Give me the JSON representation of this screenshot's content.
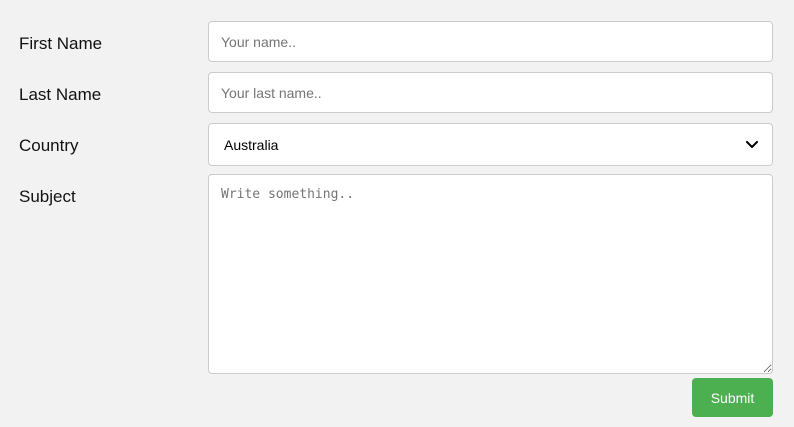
{
  "form": {
    "first_name": {
      "label": "First Name",
      "placeholder": "Your name..",
      "value": ""
    },
    "last_name": {
      "label": "Last Name",
      "placeholder": "Your last name..",
      "value": ""
    },
    "country": {
      "label": "Country",
      "selected": "Australia"
    },
    "subject": {
      "label": "Subject",
      "placeholder": "Write something..",
      "value": ""
    },
    "submit_label": "Submit"
  },
  "icons": {
    "dropdown": "chevron-down-icon"
  },
  "colors": {
    "background": "#f2f2f2",
    "submit": "#4caf50",
    "border": "#cccccc"
  }
}
